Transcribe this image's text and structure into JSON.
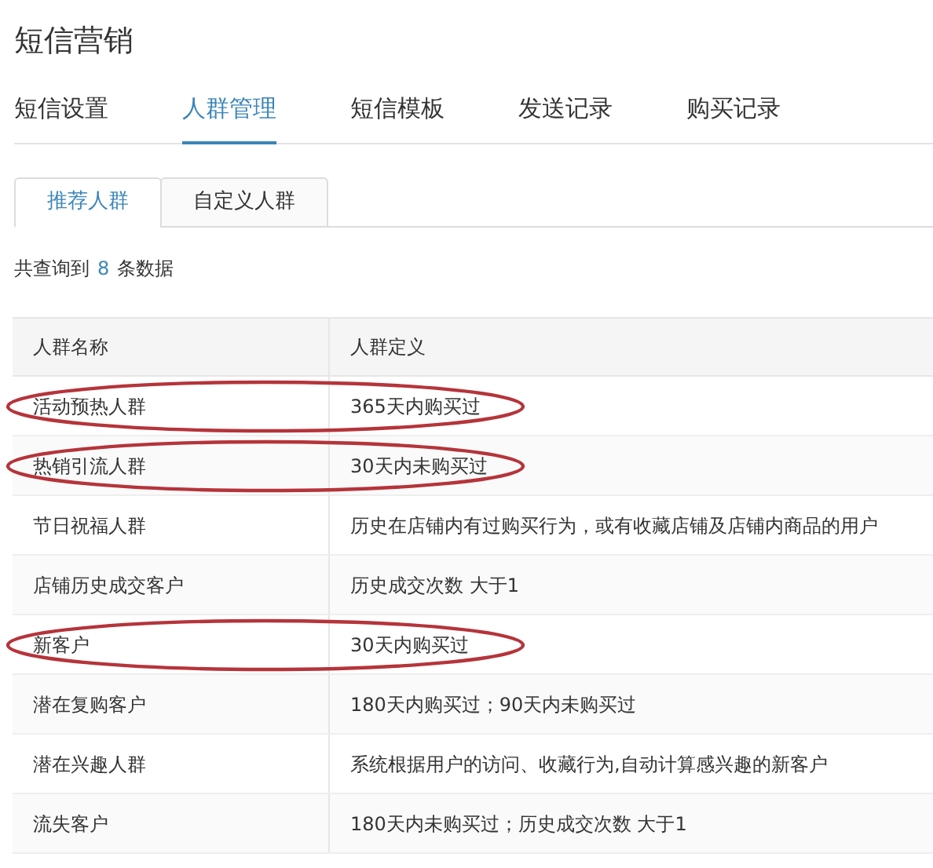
{
  "title": "短信营销",
  "tabs": [
    {
      "label": "短信设置",
      "selected": false
    },
    {
      "label": "人群管理",
      "selected": true
    },
    {
      "label": "短信模板",
      "selected": false
    },
    {
      "label": "发送记录",
      "selected": false
    },
    {
      "label": "购买记录",
      "selected": false
    }
  ],
  "sub_tabs": [
    {
      "label": "推荐人群",
      "selected": true
    },
    {
      "label": "自定义人群",
      "selected": false
    }
  ],
  "result_count": {
    "prefix": "共查询到",
    "count": "8",
    "suffix": "条数据"
  },
  "table": {
    "columns": [
      "人群名称",
      "人群定义"
    ],
    "rows": [
      {
        "name": "活动预热人群",
        "definition": "365天内购买过",
        "circled": true
      },
      {
        "name": "热销引流人群",
        "definition": "30天内未购买过",
        "circled": true
      },
      {
        "name": "节日祝福人群",
        "definition": "历史在店铺内有过购买行为，或有收藏店铺及店铺内商品的用户",
        "circled": false
      },
      {
        "name": "店铺历史成交客户",
        "definition": "历史成交次数 大于1",
        "circled": false
      },
      {
        "name": "新客户",
        "definition": "30天内购买过",
        "circled": true
      },
      {
        "name": "潜在复购客户",
        "definition": "180天内购买过；90天内未购买过",
        "circled": false
      },
      {
        "name": "潜在兴趣人群",
        "definition": "系统根据用户的访问、收藏行为,自动计算感兴趣的新客户",
        "circled": false
      },
      {
        "name": "流失客户",
        "definition": "180天内未购买过；历史成交次数 大于1",
        "circled": false
      }
    ]
  }
}
